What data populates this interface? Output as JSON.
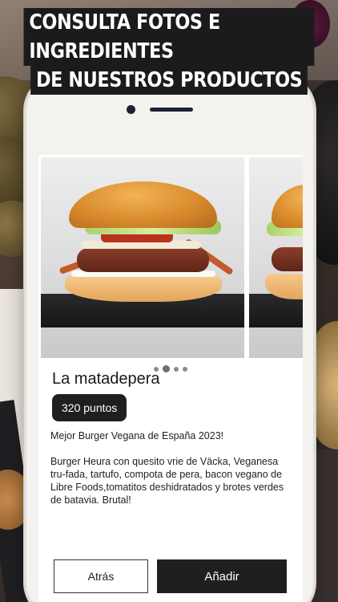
{
  "banner": {
    "line1": "CONSULTA FOTOS E INGREDIENTES",
    "line2": "DE NUESTROS PRODUCTOS"
  },
  "product": {
    "name": "La matadepera",
    "points": "320 puntos",
    "award": "Mejor Burger Vegana de España 2023!",
    "description": "Burger Heura con quesito vrie de Väcka, Veganesa tru-fada, tartufo, compota de pera, bacon vegano de Libre Foods,tomatitos deshidratados y brotes verdes de batavia. Brutal!"
  },
  "carousel": {
    "slide_count": 4,
    "active_index": 1
  },
  "actions": {
    "back_label": "Atrás",
    "add_label": "Añadir"
  }
}
